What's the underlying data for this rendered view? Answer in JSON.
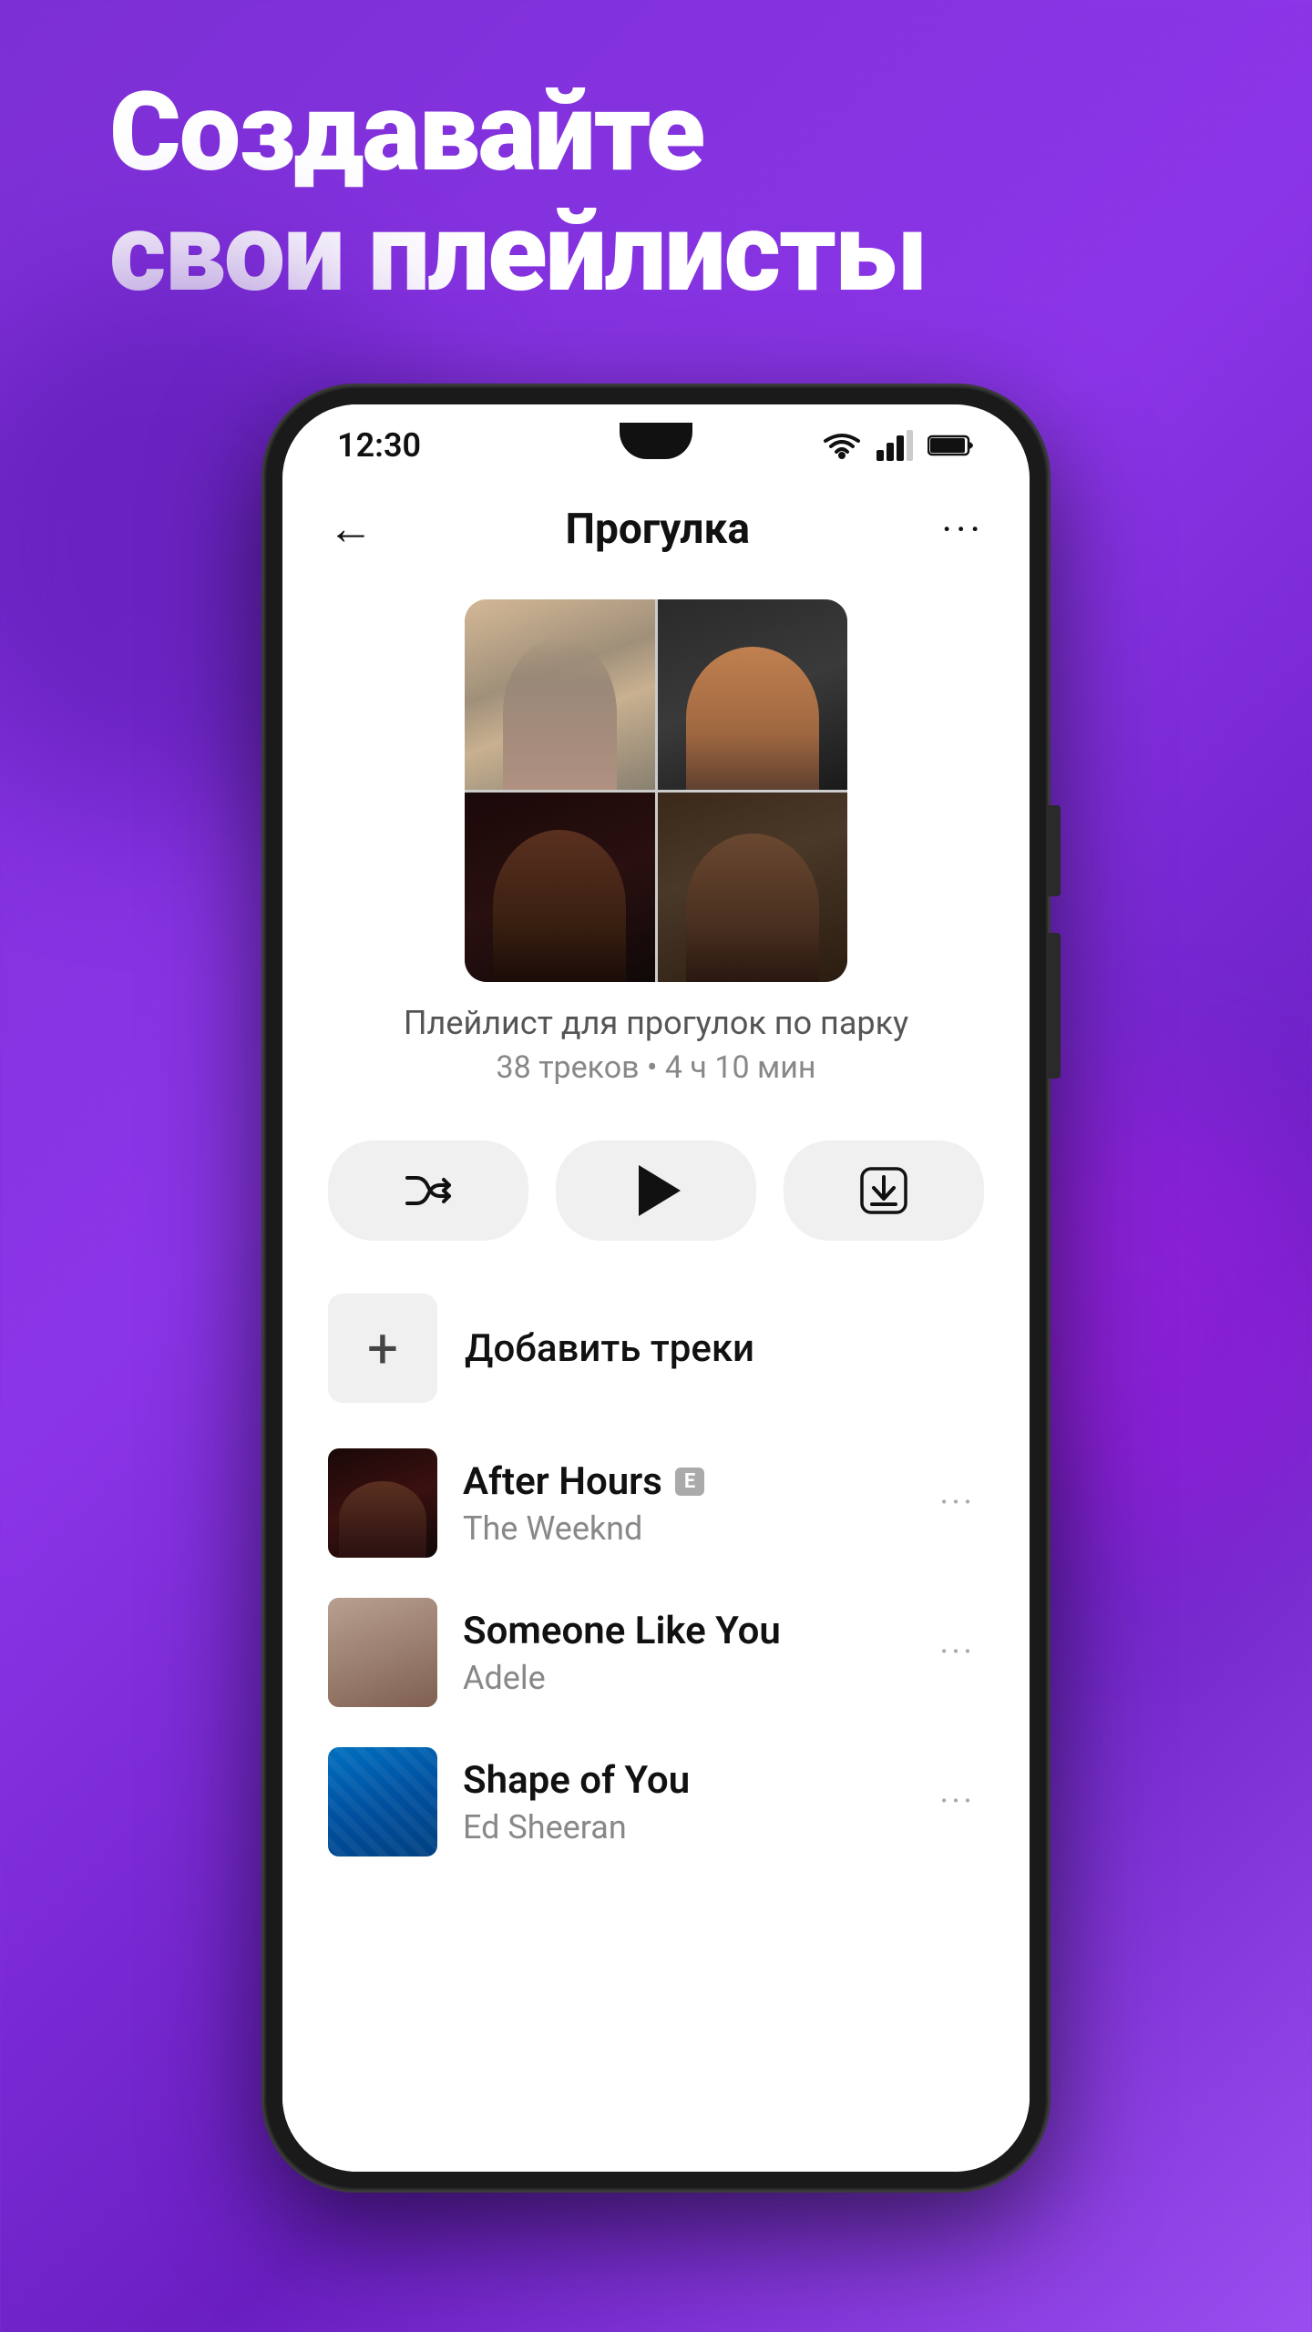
{
  "hero": {
    "line1": "Создавайте",
    "line2": "свои плейлисты"
  },
  "status_bar": {
    "time": "12:30",
    "wifi": "wifi",
    "signal": "signal",
    "battery": "battery"
  },
  "nav": {
    "back_label": "←",
    "title": "Прогулка",
    "more_label": "···"
  },
  "playlist": {
    "name": "Плейлист для прогулок по парку",
    "meta": "38 треков • 4 ч 10 мин"
  },
  "actions": {
    "shuffle_label": "shuffle",
    "play_label": "play",
    "download_label": "download"
  },
  "add_tracks": {
    "label": "Добавить треки"
  },
  "tracks": [
    {
      "title": "After Hours",
      "artist": "The Weeknd",
      "explicit": true,
      "art_class": "track-art-weeknd"
    },
    {
      "title": "Someone Like You",
      "artist": "Adele",
      "explicit": false,
      "art_class": "track-art-adele"
    },
    {
      "title": "Shape of You",
      "artist": "Ed Sheeran",
      "explicit": false,
      "art_class": "track-art-ed"
    }
  ],
  "explicit_badge": "E"
}
